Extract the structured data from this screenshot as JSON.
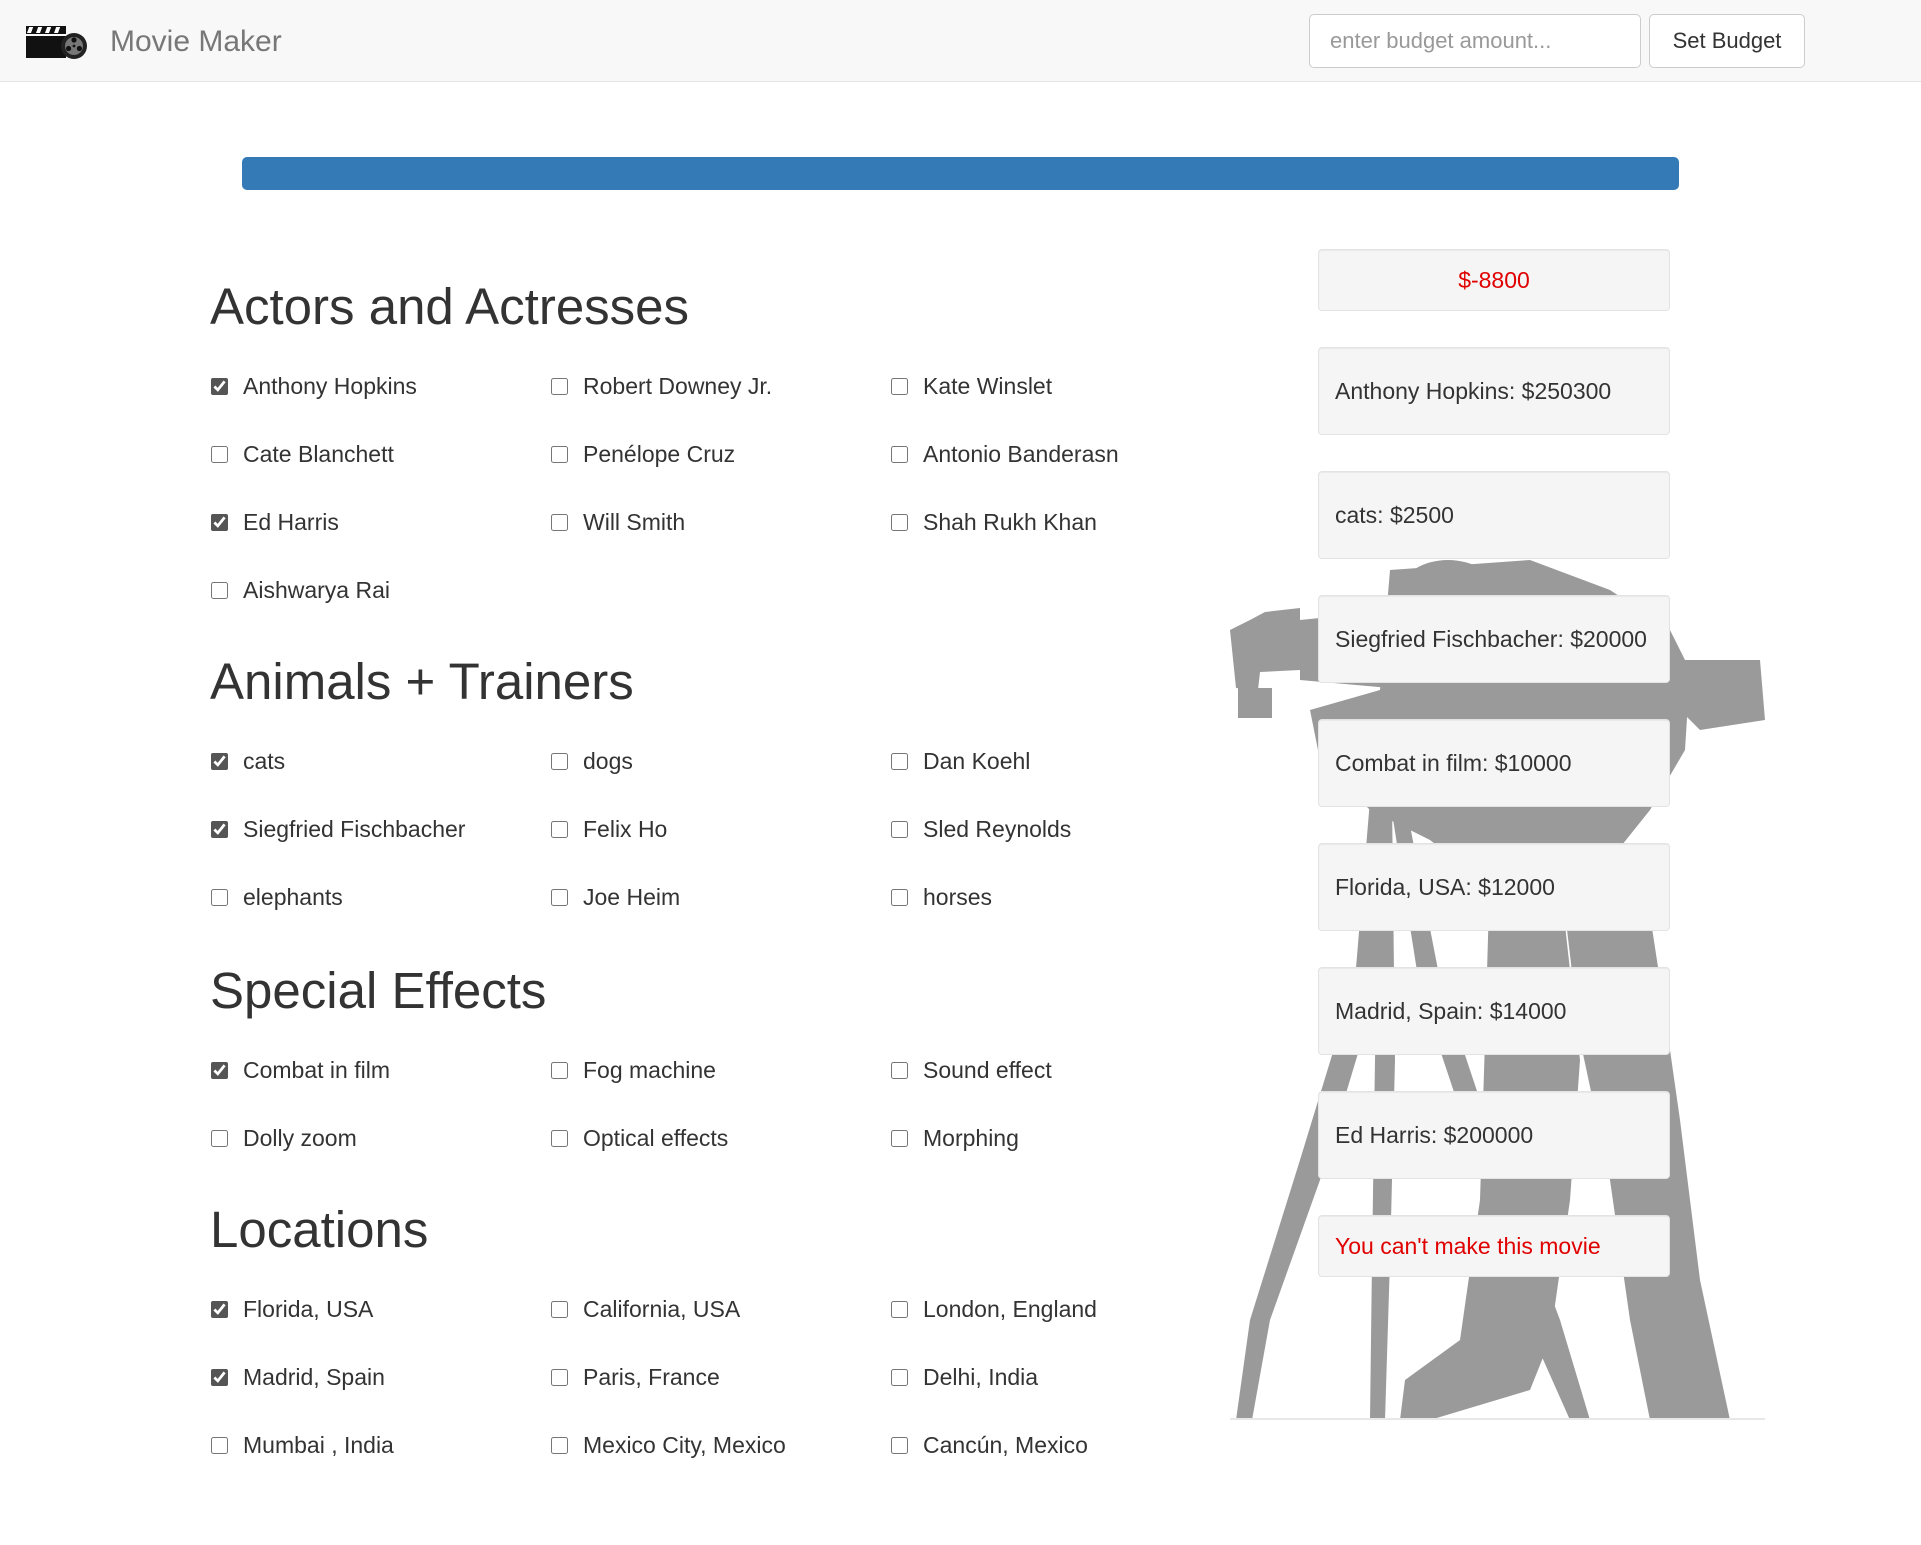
{
  "app": {
    "title": "Movie Maker",
    "logo_icon": "film-clapperboard-icon"
  },
  "budget": {
    "placeholder": "enter budget amount...",
    "value": "",
    "button_label": "Set Budget"
  },
  "progress": {
    "fraction": 1.0,
    "color": "#337ab7"
  },
  "sections": [
    {
      "title": "Actors and Actresses",
      "options": [
        {
          "label": "Anthony Hopkins",
          "checked": true
        },
        {
          "label": "Robert Downey Jr.",
          "checked": false
        },
        {
          "label": "Kate Winslet",
          "checked": false
        },
        {
          "label": "Cate Blanchett",
          "checked": false
        },
        {
          "label": "Penélope Cruz",
          "checked": false
        },
        {
          "label": "Antonio Banderasn",
          "checked": false
        },
        {
          "label": "Ed Harris",
          "checked": true
        },
        {
          "label": "Will Smith",
          "checked": false
        },
        {
          "label": "Shah Rukh Khan",
          "checked": false
        },
        {
          "label": "Aishwarya Rai",
          "checked": false
        }
      ]
    },
    {
      "title": "Animals + Trainers",
      "options": [
        {
          "label": "cats",
          "checked": true
        },
        {
          "label": "dogs",
          "checked": false
        },
        {
          "label": "Dan Koehl",
          "checked": false
        },
        {
          "label": "Siegfried Fischbacher",
          "checked": true
        },
        {
          "label": "Felix Ho",
          "checked": false
        },
        {
          "label": "Sled Reynolds",
          "checked": false
        },
        {
          "label": "elephants",
          "checked": false
        },
        {
          "label": "Joe Heim",
          "checked": false
        },
        {
          "label": "horses",
          "checked": false
        }
      ]
    },
    {
      "title": "Special Effects",
      "options": [
        {
          "label": "Combat in film",
          "checked": true
        },
        {
          "label": "Fog machine",
          "checked": false
        },
        {
          "label": "Sound effect",
          "checked": false
        },
        {
          "label": "Dolly zoom",
          "checked": false
        },
        {
          "label": "Optical effects",
          "checked": false
        },
        {
          "label": "Morphing",
          "checked": false
        }
      ]
    },
    {
      "title": "Locations",
      "options": [
        {
          "label": "Florida, USA",
          "checked": true
        },
        {
          "label": "California, USA",
          "checked": false
        },
        {
          "label": "London, England",
          "checked": false
        },
        {
          "label": "Madrid, Spain",
          "checked": true
        },
        {
          "label": "Paris, France",
          "checked": false
        },
        {
          "label": "Delhi, India",
          "checked": false
        },
        {
          "label": "Mumbai , India",
          "checked": false
        },
        {
          "label": "Mexico City, Mexico",
          "checked": false
        },
        {
          "label": "Cancún, Mexico",
          "checked": false
        }
      ]
    }
  ],
  "summary": {
    "balance": "$-8800",
    "balance_color": "#e00000",
    "items": [
      "Anthony Hopkins: $250300",
      "cats: $2500",
      "Siegfried Fischbacher: $20000",
      "Combat in film: $10000",
      "Florida, USA: $12000",
      "Madrid, Spain: $14000",
      "Ed Harris: $200000"
    ],
    "message": "You can't make this movie",
    "background_icon": "cameraman-silhouette-icon"
  }
}
